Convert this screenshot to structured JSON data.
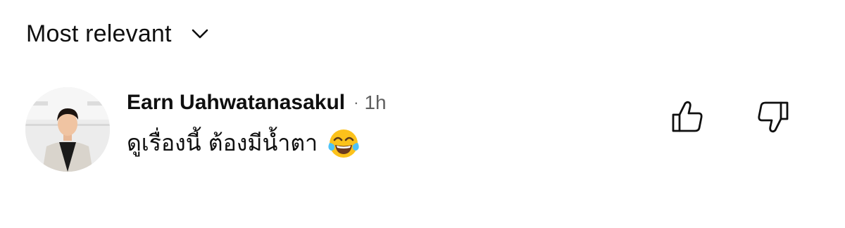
{
  "sort": {
    "label": "Most relevant"
  },
  "comment": {
    "author": "Earn Uahwatanasakul",
    "separator": "·",
    "time": "1h",
    "text": "ดูเรื่องนี้ ต้องมีน้ำตา",
    "emoji": "face-with-tears-of-joy"
  },
  "icons": {
    "chevron": "chevron-down-icon",
    "like": "thumbs-up-icon",
    "dislike": "thumbs-down-icon"
  },
  "colors": {
    "text": "#0f0f0f",
    "secondary_text": "#606060",
    "emoji_face": "#fcc21b",
    "emoji_tears": "#4fc3f7"
  }
}
